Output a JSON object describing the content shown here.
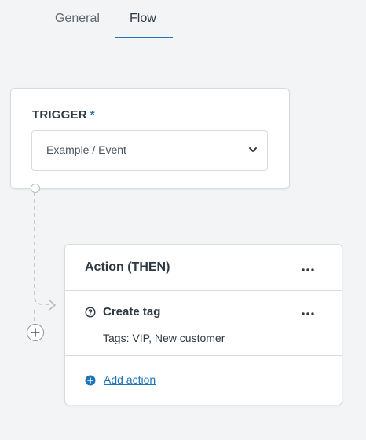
{
  "tabs": [
    {
      "label": "General",
      "active": false
    },
    {
      "label": "Flow",
      "active": true
    }
  ],
  "trigger": {
    "label": "TRIGGER",
    "required_mark": "*",
    "select_value": "Example / Event"
  },
  "action_block": {
    "title": "Action (THEN)",
    "items": [
      {
        "name": "Create tag",
        "detail": "Tags: VIP, New customer",
        "icon": "help-circle-icon"
      }
    ],
    "add_action_label": "Add action"
  },
  "icons": {
    "more": "more-horizontal-icon",
    "chevron": "chevron-down-icon",
    "add": "plus-circle-icon"
  },
  "colors": {
    "accent": "#1f73b7",
    "text": "#2f3941",
    "border": "#d8dcde",
    "background": "#f3f4f6"
  }
}
